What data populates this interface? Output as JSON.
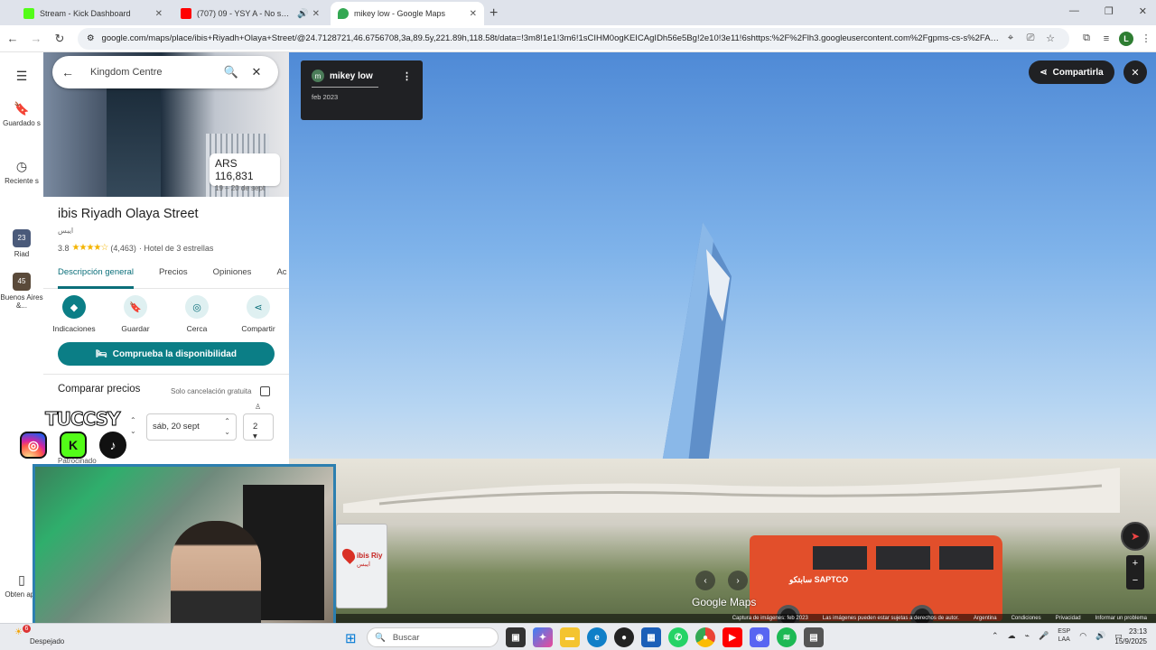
{
  "browser": {
    "tabs": [
      {
        "title": "Stream - Kick Dashboard",
        "favicon_color": "#53fc18"
      },
      {
        "title": "(707) 09 - YSY A - No se - R",
        "favicon_color": "#ff0000"
      },
      {
        "title": "mikey low - Google Maps",
        "favicon_color": "#34a853"
      }
    ],
    "new_tab": "+",
    "url": "google.com/maps/place/ibis+Riyadh+Olaya+Street/@24.7128721,46.6756708,3a,89.5y,221.89h,118.58t/data=!3m8!1e1!3m6!1sCIHM0ogKEICAgIDh56e5Bg!2e10!3e11!6shttps:%2F%2Flh3.googleusercontent.com%2Fgpms-cs-s%2FAB8u6Hb...",
    "profile_initial": "L"
  },
  "rail": {
    "items": [
      {
        "label": "Guardado s",
        "icon": "bookmark-icon"
      },
      {
        "label": "Reciente s",
        "icon": "history-icon"
      },
      {
        "label": "Riad",
        "badge": "23"
      },
      {
        "label": "Buenos Aires &...",
        "badge": "45"
      },
      {
        "label": "Obten app",
        "icon": "phone-icon"
      }
    ]
  },
  "panel": {
    "search_query": "Kingdom Centre",
    "price": "ARS 116,831",
    "dates": "19 – 20 de sept",
    "hotel_name": "ibis Riyadh Olaya Street",
    "hotel_name_ar": "ايبس",
    "rating": "3.8",
    "stars": "★★★★☆",
    "reviews": "(4,463)",
    "category": "· Hotel de 3 estrellas",
    "tabs": [
      "Descripción general",
      "Precios",
      "Opiniones",
      "Ac"
    ],
    "actions": [
      "Indicaciones",
      "Guardar",
      "Cerca",
      "Compartir"
    ],
    "availability_button": "Comprueba la disponibilidad",
    "compare_title": "Comparar precios",
    "free_cancel": "Solo cancelación gratuita",
    "checkout": "sáb, 20 sept",
    "guests": "2",
    "cut_text": "Patrocinado"
  },
  "streetview": {
    "contributor": "mikey low",
    "contributor_initial": "m",
    "date": "feb 2023",
    "share": "Compartirla",
    "logo": "Google Maps",
    "minimap_label": "ibis Riy",
    "minimap_label_ar": "ايبس",
    "footer": [
      "Captura de imágenes: feb 2023",
      "Las imágenes pueden estar sujetas a derechos de autor.",
      "Argentina",
      "Condiciones",
      "Privacidad",
      "Informar un problema"
    ],
    "bus_text": "سابتكو SAPTCO"
  },
  "overlay": {
    "brand": "TUCCSY"
  },
  "taskbar": {
    "weather_temp": "6",
    "weather_text": "Despejado",
    "search_placeholder": "Buscar",
    "lang_1": "ESP",
    "lang_2": "LAA",
    "time": "23:13",
    "date": "15/9/2025"
  }
}
